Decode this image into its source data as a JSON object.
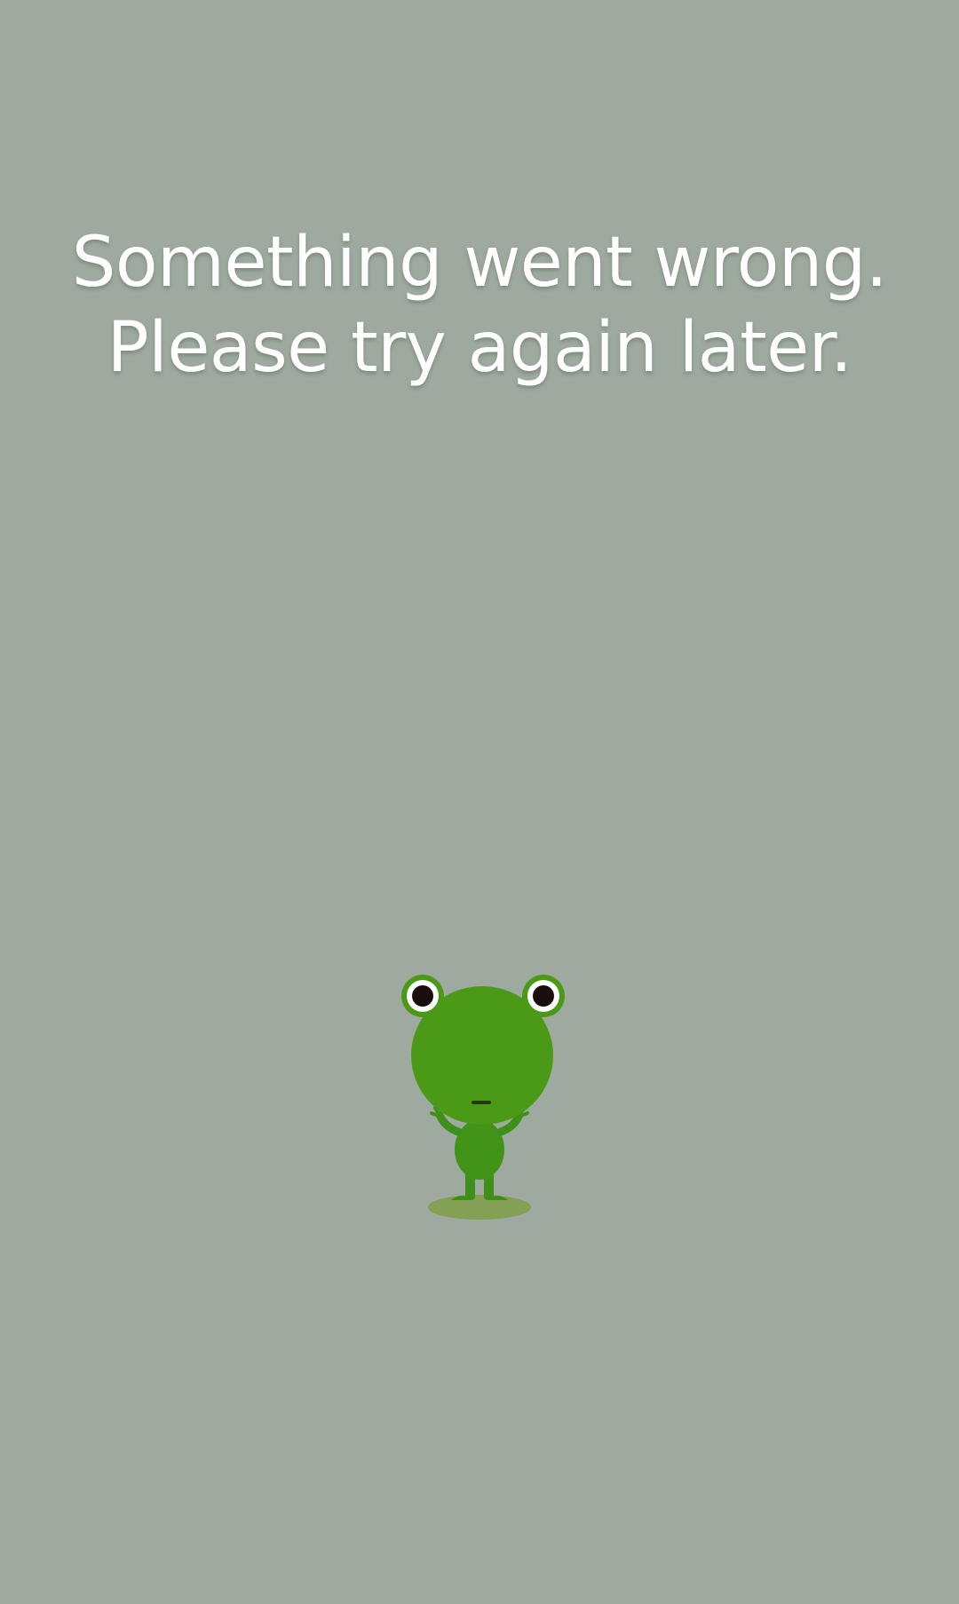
{
  "error": {
    "line1": "Something went wrong.",
    "line2": "Please try again later."
  },
  "mascot": {
    "icon": "frog-mascot-icon"
  },
  "colors": {
    "background": "#9eaaa0",
    "text": "#ffffff",
    "frog_green": "#4a9a18",
    "frog_dark": "#3a8a14",
    "lily_pad": "#7a9a48"
  }
}
